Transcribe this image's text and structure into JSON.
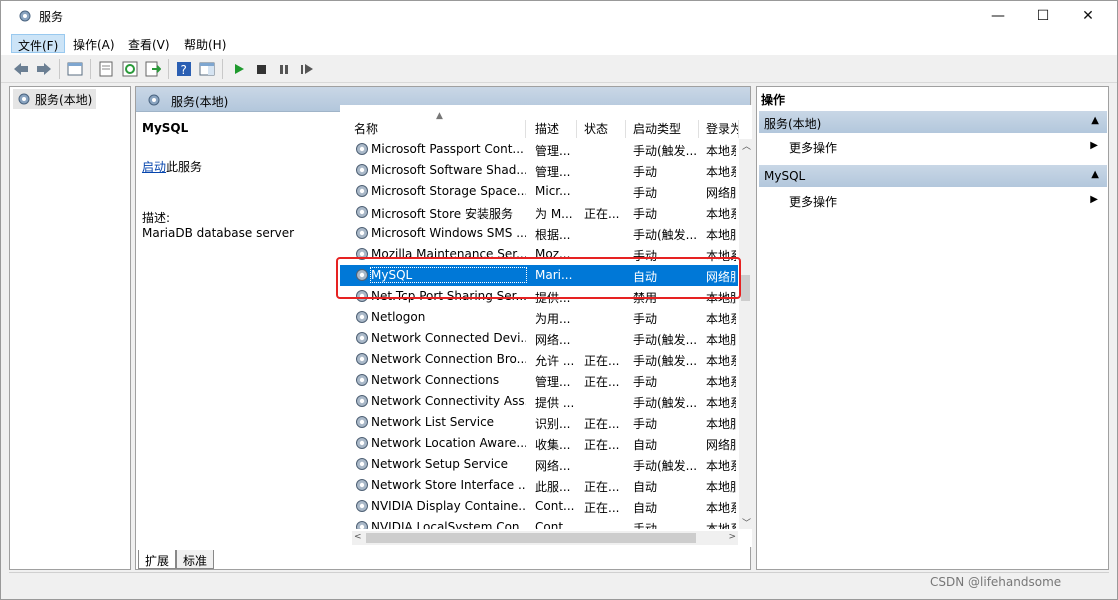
{
  "window": {
    "title": "服务",
    "min": "—",
    "max": "☐",
    "close": "✕"
  },
  "menu": [
    "文件(F)",
    "操作(A)",
    "查看(V)",
    "帮助(H)"
  ],
  "tree": {
    "label": "服务(本地)"
  },
  "center": {
    "header": "服务(本地)",
    "service_name": "MySQL",
    "start_link": "启动",
    "start_suffix": "此服务",
    "desc_label": "描述:",
    "desc_text": "MariaDB database server"
  },
  "columns": [
    "名称",
    "描述",
    "状态",
    "启动类型",
    "登录为"
  ],
  "rows": [
    {
      "name": "Microsoft Passport Cont...",
      "desc": "管理...",
      "status": "",
      "start": "手动(触发...",
      "login": "本地系"
    },
    {
      "name": "Microsoft Software Shad...",
      "desc": "管理...",
      "status": "",
      "start": "手动",
      "login": "本地系"
    },
    {
      "name": "Microsoft Storage Space...",
      "desc": "Micr...",
      "status": "",
      "start": "手动",
      "login": "网络服"
    },
    {
      "name": "Microsoft Store 安装服务",
      "desc": "为 M...",
      "status": "正在...",
      "start": "手动",
      "login": "本地系"
    },
    {
      "name": "Microsoft Windows SMS ...",
      "desc": "根据...",
      "status": "",
      "start": "手动(触发...",
      "login": "本地服"
    },
    {
      "name": "Mozilla Maintenance Ser...",
      "desc": "Moz...",
      "status": "",
      "start": "手动",
      "login": "本地系"
    },
    {
      "name": "MySQL",
      "desc": "Mari...",
      "status": "",
      "start": "自动",
      "login": "网络服",
      "selected": true
    },
    {
      "name": "Net.Tcp Port Sharing Ser...",
      "desc": "提供...",
      "status": "",
      "start": "禁用",
      "login": "本地服"
    },
    {
      "name": "Netlogon",
      "desc": "为用...",
      "status": "",
      "start": "手动",
      "login": "本地系"
    },
    {
      "name": "Network Connected Devi...",
      "desc": "网络...",
      "status": "",
      "start": "手动(触发...",
      "login": "本地服"
    },
    {
      "name": "Network Connection Bro...",
      "desc": "允许 ...",
      "status": "正在...",
      "start": "手动(触发...",
      "login": "本地系"
    },
    {
      "name": "Network Connections",
      "desc": "管理...",
      "status": "正在...",
      "start": "手动",
      "login": "本地系"
    },
    {
      "name": "Network Connectivity Ass...",
      "desc": "提供 ...",
      "status": "",
      "start": "手动(触发...",
      "login": "本地系"
    },
    {
      "name": "Network List Service",
      "desc": "识别...",
      "status": "正在...",
      "start": "手动",
      "login": "本地服"
    },
    {
      "name": "Network Location Aware...",
      "desc": "收集...",
      "status": "正在...",
      "start": "自动",
      "login": "网络服"
    },
    {
      "name": "Network Setup Service",
      "desc": "网络...",
      "status": "",
      "start": "手动(触发...",
      "login": "本地系"
    },
    {
      "name": "Network Store Interface ...",
      "desc": "此服...",
      "status": "正在...",
      "start": "自动",
      "login": "本地服"
    },
    {
      "name": "NVIDIA Display Containe...",
      "desc": "Cont...",
      "status": "正在...",
      "start": "自动",
      "login": "本地系"
    },
    {
      "name": "NVIDIA LocalSystem Con...",
      "desc": "Cont...",
      "status": "",
      "start": "手动",
      "login": "本地系"
    }
  ],
  "tabs": [
    "扩展",
    "标准"
  ],
  "actions": {
    "title": "操作",
    "groups": [
      {
        "header": "服务(本地)",
        "item": "更多操作"
      },
      {
        "header": "MySQL",
        "item": "更多操作"
      }
    ]
  },
  "watermark": "CSDN @lifehandsome",
  "colors": {
    "selection": "#0078d7",
    "highlight_box": "#e62222",
    "panel_header": "#b3c7dc"
  }
}
